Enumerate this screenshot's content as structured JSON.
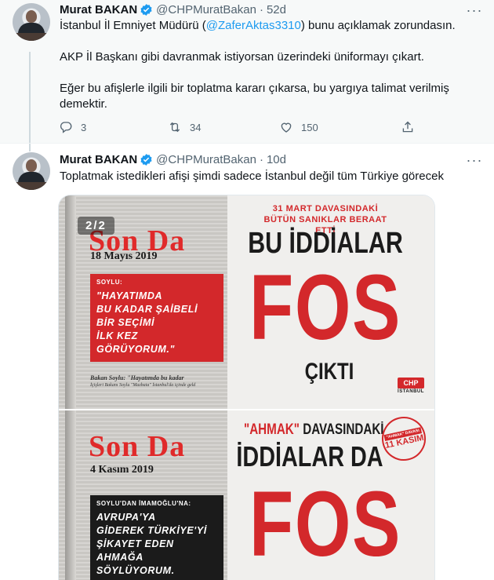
{
  "tweets": [
    {
      "author_name": "Murat BAKAN",
      "handle": "@CHPMuratBakan",
      "separator": "·",
      "time": "52d",
      "more": "···",
      "text_pre": "İstanbul İl Emniyet Müdürü (",
      "mention": "@ZaferAktas3310",
      "text_post": ") bunu açıklamak zorundasın.",
      "paragraph2": "AKP İl Başkanı gibi davranmak istiyorsan üzerindeki üniformayı çıkart.",
      "paragraph3": "Eğer bu afişlerle ilgili bir toplatma kararı çıkarsa, bu yargıya talimat verilmiş demektir.",
      "reply_count": "3",
      "retweet_count": "34",
      "like_count": "150",
      "icons": [
        "reply-icon",
        "retweet-icon",
        "like-icon",
        "share-icon"
      ]
    },
    {
      "author_name": "Murat BAKAN",
      "handle": "@CHPMuratBakan",
      "separator": "·",
      "time": "10d",
      "more": "···",
      "text": "Toplatmak istedikleri afişi şimdi sadece İstanbul değil tüm Türkiye görecek"
    }
  ],
  "media": {
    "badge": "2/2",
    "poster1": {
      "newspaper": "Son Da",
      "date": "18 Mayıs 2019",
      "quote_label": "SOYLU:",
      "quote_lines": [
        "\"HAYATIMDA",
        "BU KADAR ŞAİBELİ",
        "BİR SEÇİMİ",
        "İLK KEZ",
        "GÖRÜYORUM.\""
      ],
      "caption_bold": "Bakan Soylu: \"Hayatımda bu kadar",
      "caption_small": "İçişleri Bakanı Soylu \"Mazbata\" İstanbul'da içinde geld",
      "kicker_line1": "31 MART DAVASINDAKİ",
      "kicker_line2": "BÜTÜN SANIKLAR BERAAT ETTİ",
      "headline1": "BU İDDİALAR",
      "headline2": "FOS",
      "headline3": "ÇIKTI",
      "logo": "CHP",
      "logo_city": "İSTANBUL"
    },
    "poster2": {
      "newspaper": "Son Da",
      "date": "4 Kasım 2019",
      "quote_label": "SOYLU'DAN İMAMOĞLU'NA:",
      "quote_lines": [
        "AVRUPA'YA",
        "GİDEREK TÜRKİYE'Yİ",
        "ŞİKAYET EDEN",
        "AHMAĞA",
        "SÖYLÜYORUM."
      ],
      "headline1_quoted": "\"AHMAK\"",
      "headline1_rest": " DAVASINDAKİ",
      "headline2": "İDDİALAR DA",
      "headline3": "FOS",
      "stamp_tag": "\"AHMAK\" DAVASI",
      "stamp_date": "11 KASIM"
    }
  },
  "colors": {
    "accent": "#1d9bf0",
    "poster_red": "#d3282b",
    "muted_text": "#536471"
  }
}
